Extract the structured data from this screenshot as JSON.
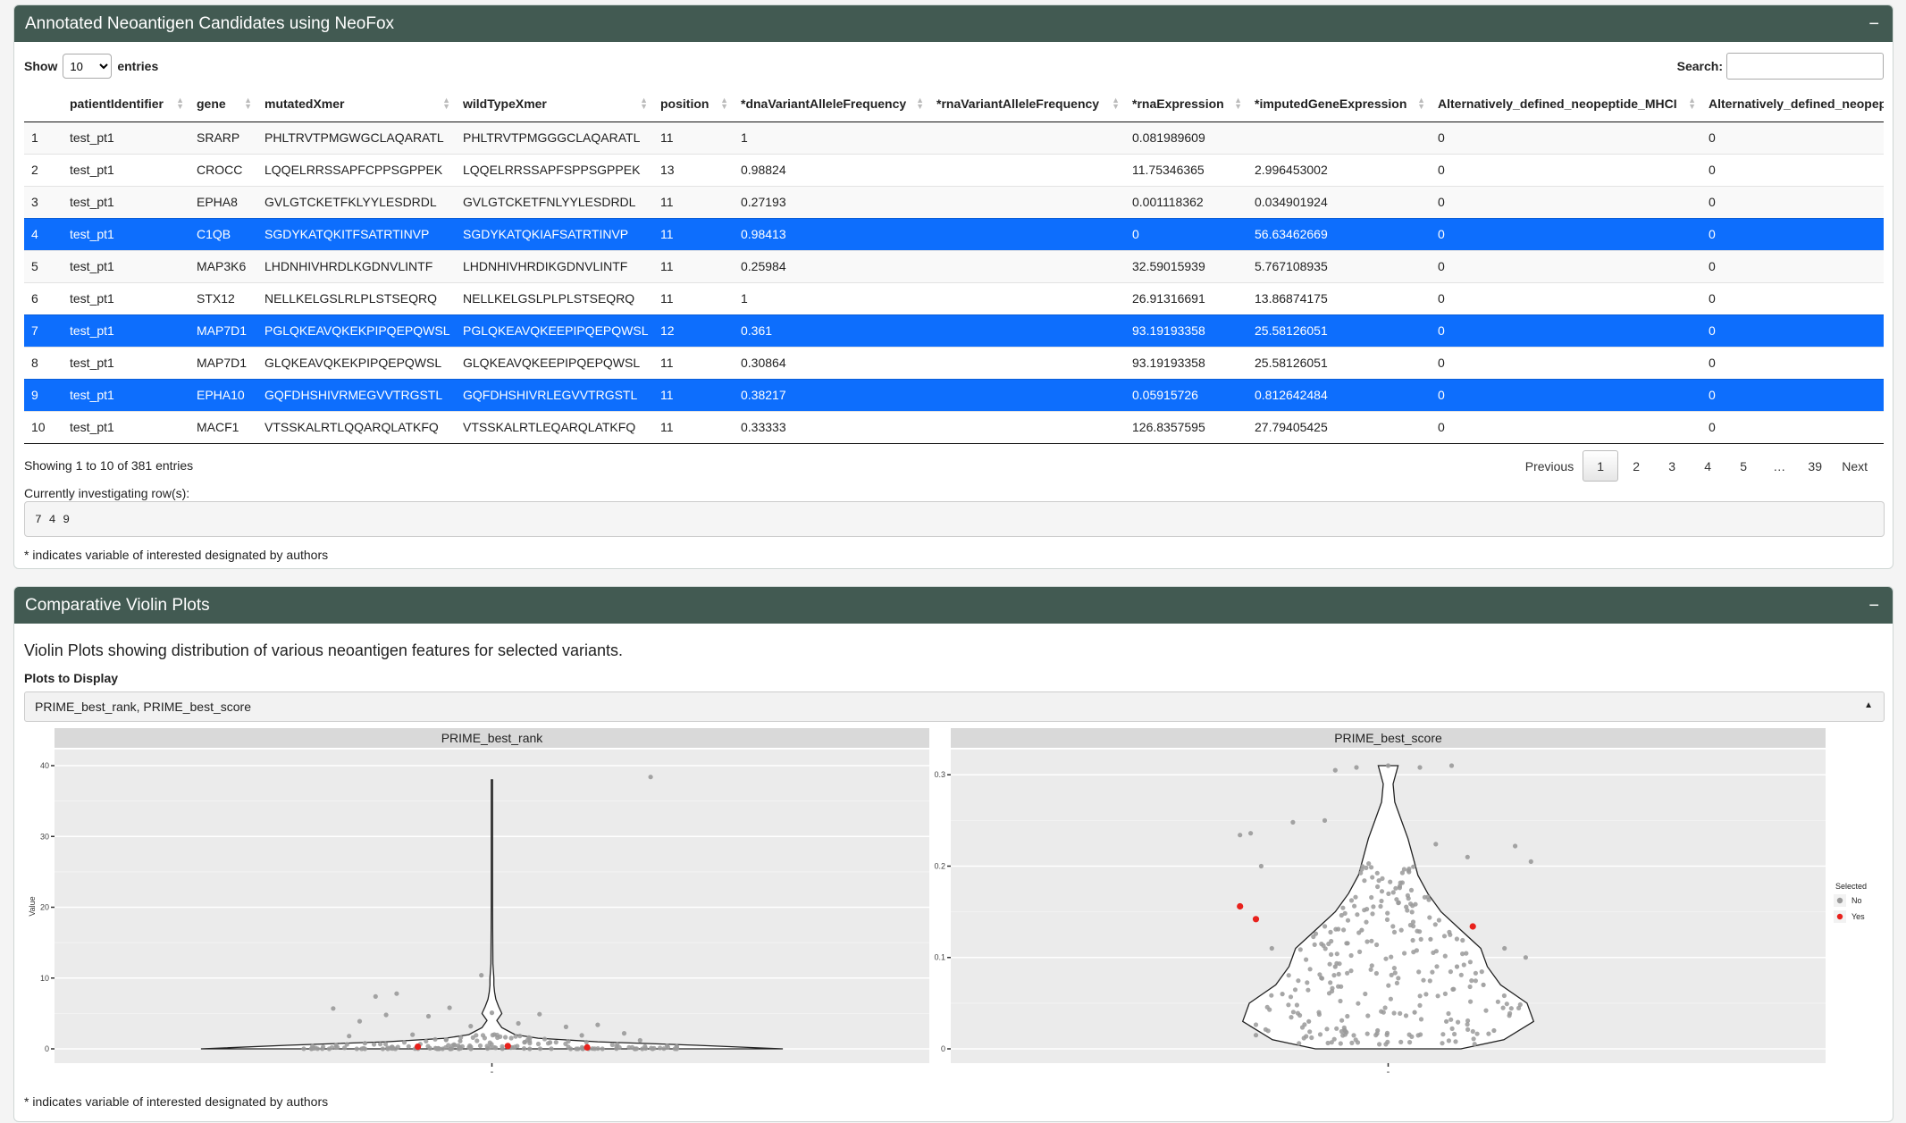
{
  "neofox_box": {
    "title": "Annotated Neoantigen Candidates using NeoFox",
    "collapse_glyph": "−",
    "show_label": "Show",
    "entries_label": "entries",
    "page_length": "10",
    "search_label": "Search:",
    "search_value": "",
    "columns": [
      "",
      "patientIdentifier",
      "gene",
      "mutatedXmer",
      "wildTypeXmer",
      "position",
      "*dnaVariantAlleleFrequency",
      "*rnaVariantAlleleFrequency",
      "*rnaExpression",
      "*imputedGeneExpression",
      "Alternatively_defined_neopeptide_MHCI",
      "Alternatively_defined_neopeptid"
    ],
    "rows": [
      {
        "cells": [
          "1",
          "test_pt1",
          "SRARP",
          "PHLTRVTPMGWGCLAQARATL",
          "PHLTRVTPMGGGCLAQARATL",
          "11",
          "1",
          "",
          "0.081989609",
          "",
          "0",
          "0"
        ],
        "selected": false
      },
      {
        "cells": [
          "2",
          "test_pt1",
          "CROCC",
          "LQQELRRSSAPFCPPSGPPEK",
          "LQQELRRSSAPFSPPSGPPEK",
          "13",
          "0.98824",
          "",
          "11.75346365",
          "2.996453002",
          "0",
          "0"
        ],
        "selected": false
      },
      {
        "cells": [
          "3",
          "test_pt1",
          "EPHA8",
          "GVLGTCKETFKLYYLESDRDL",
          "GVLGTCKETFNLYYLESDRDL",
          "11",
          "0.27193",
          "",
          "0.001118362",
          "0.034901924",
          "0",
          "0"
        ],
        "selected": false
      },
      {
        "cells": [
          "4",
          "test_pt1",
          "C1QB",
          "SGDYKATQKITFSATRTINVP",
          "SGDYKATQKIAFSATRTINVP",
          "11",
          "0.98413",
          "",
          "0",
          "56.63462669",
          "0",
          "0"
        ],
        "selected": true
      },
      {
        "cells": [
          "5",
          "test_pt1",
          "MAP3K6",
          "LHDNHIVHRDLKGDNVLINTF",
          "LHDNHIVHRDIKGDNVLINTF",
          "11",
          "0.25984",
          "",
          "32.59015939",
          "5.767108935",
          "0",
          "0"
        ],
        "selected": false
      },
      {
        "cells": [
          "6",
          "test_pt1",
          "STX12",
          "NELLKELGSLRLPLSTSEQRQ",
          "NELLKELGSLPLPLSTSEQRQ",
          "11",
          "1",
          "",
          "26.91316691",
          "13.86874175",
          "0",
          "0"
        ],
        "selected": false
      },
      {
        "cells": [
          "7",
          "test_pt1",
          "MAP7D1",
          "PGLQKEAVQKEKPIPQEPQWSL",
          "PGLQKEAVQKEEPIPQEPQWSL",
          "12",
          "0.361",
          "",
          "93.19193358",
          "25.58126051",
          "0",
          "0"
        ],
        "selected": true
      },
      {
        "cells": [
          "8",
          "test_pt1",
          "MAP7D1",
          "GLQKEAVQKEKPIPQEPQWSL",
          "GLQKEAVQKEEPIPQEPQWSL",
          "11",
          "0.30864",
          "",
          "93.19193358",
          "25.58126051",
          "0",
          "0"
        ],
        "selected": false
      },
      {
        "cells": [
          "9",
          "test_pt1",
          "EPHA10",
          "GQFDHSHIVRMEGVVTRGSTL",
          "GQFDHSHIVRLEGVVTRGSTL",
          "11",
          "0.38217",
          "",
          "0.05915726",
          "0.812642484",
          "0",
          "0"
        ],
        "selected": true
      },
      {
        "cells": [
          "10",
          "test_pt1",
          "MACF1",
          "VTSSKALRTLQQARQLATKFQ",
          "VTSSKALRTLEQARQLATKFQ",
          "11",
          "0.33333",
          "",
          "126.8357595",
          "27.79405425",
          "0",
          "0"
        ],
        "selected": false
      }
    ],
    "info": "Showing 1 to 10 of 381 entries",
    "pagination": {
      "previous": "Previous",
      "pages": [
        "1",
        "2",
        "3",
        "4",
        "5",
        "…",
        "39"
      ],
      "current": "1",
      "next": "Next"
    },
    "investigating_label": "Currently investigating row(s):",
    "investigating_rows": "7 4 9",
    "footnote": "* indicates variable of interested designated by authors"
  },
  "violin_box": {
    "title": "Comparative Violin Plots",
    "collapse_glyph": "−",
    "description": "Violin Plots showing distribution of various neoantigen features for selected variants.",
    "plots_label": "Plots to Display",
    "plots_selected": "PRIME_best_rank, PRIME_best_score",
    "caret": "▲",
    "footnote": "* indicates variable of interested designated by authors"
  },
  "colors": {
    "header_bg": "#425a52",
    "selected_row": "#0d6efd",
    "point_no": "#9a9a9a",
    "point_yes": "#e8211c",
    "panel_bg": "#ebebeb",
    "strip_bg": "#d9d9d9"
  },
  "chart_data": [
    {
      "type": "violin",
      "title": "PRIME_best_rank",
      "ylabel": "Value",
      "xlabel": "",
      "x_tick_labels": [
        "-"
      ],
      "ylim": [
        0,
        40
      ],
      "y_ticks": [
        0,
        10,
        20,
        30,
        40
      ],
      "grid": true,
      "violin_profile": [
        [
          0,
          0.88
        ],
        [
          0.5,
          0.62
        ],
        [
          1,
          0.32
        ],
        [
          1.5,
          0.14
        ],
        [
          2,
          0.07
        ],
        [
          3,
          0.03
        ],
        [
          4,
          0.015
        ],
        [
          5,
          0.03
        ],
        [
          6,
          0.02
        ],
        [
          7,
          0.012
        ],
        [
          8,
          0.008
        ],
        [
          9,
          0.006
        ],
        [
          10,
          0.006
        ],
        [
          12,
          0.003
        ],
        [
          20,
          0.002
        ],
        [
          38,
          0.002
        ]
      ],
      "points_selected": [
        {
          "x": -0.14,
          "y": 0.3
        },
        {
          "x": 0.03,
          "y": 0.4
        },
        {
          "x": 0.18,
          "y": 0.2
        }
      ],
      "points_not_selected_sample": [
        {
          "x": -0.3,
          "y": 5.7
        },
        {
          "x": -0.25,
          "y": 3.9
        },
        {
          "x": -0.22,
          "y": 7.4
        },
        {
          "x": -0.18,
          "y": 7.8
        },
        {
          "x": -0.2,
          "y": 4.8
        },
        {
          "x": -0.12,
          "y": 4.6
        },
        {
          "x": -0.08,
          "y": 5.8
        },
        {
          "x": -0.04,
          "y": 3.2
        },
        {
          "x": -0.02,
          "y": 10.4
        },
        {
          "x": 0.0,
          "y": 5.1
        },
        {
          "x": 0.05,
          "y": 3.6
        },
        {
          "x": 0.09,
          "y": 4.9
        },
        {
          "x": 0.14,
          "y": 3.1
        },
        {
          "x": 0.2,
          "y": 3.4
        },
        {
          "x": 0.3,
          "y": 38.4
        },
        {
          "x": -0.27,
          "y": 1.8
        },
        {
          "x": -0.15,
          "y": 2.0
        },
        {
          "x": 0.07,
          "y": 1.6
        },
        {
          "x": 0.17,
          "y": 1.9
        },
        {
          "x": 0.25,
          "y": 2.2
        },
        {
          "x": -0.24,
          "y": 0.8
        },
        {
          "x": -0.06,
          "y": 1.1
        },
        {
          "x": 0.11,
          "y": 0.9
        },
        {
          "x": 0.28,
          "y": 1.2
        }
      ]
    },
    {
      "type": "violin",
      "title": "PRIME_best_score",
      "ylabel": "",
      "xlabel": "",
      "x_tick_labels": [
        "-"
      ],
      "ylim": [
        0,
        0.31
      ],
      "y_ticks": [
        0.0,
        0.1,
        0.2,
        0.3
      ],
      "grid": true,
      "violin_profile": [
        [
          0,
          0.22
        ],
        [
          0.01,
          0.35
        ],
        [
          0.03,
          0.44
        ],
        [
          0.05,
          0.42
        ],
        [
          0.07,
          0.34
        ],
        [
          0.09,
          0.3
        ],
        [
          0.11,
          0.28
        ],
        [
          0.13,
          0.22
        ],
        [
          0.15,
          0.16
        ],
        [
          0.17,
          0.12
        ],
        [
          0.19,
          0.09
        ],
        [
          0.21,
          0.075
        ],
        [
          0.23,
          0.06
        ],
        [
          0.25,
          0.04
        ],
        [
          0.27,
          0.02
        ],
        [
          0.29,
          0.015
        ],
        [
          0.31,
          0.03
        ]
      ],
      "points_selected": [
        {
          "x": -0.28,
          "y": 0.156
        },
        {
          "x": -0.25,
          "y": 0.142
        },
        {
          "x": 0.16,
          "y": 0.134
        }
      ],
      "points_not_selected_sample": [
        {
          "x": -0.28,
          "y": 0.234
        },
        {
          "x": -0.26,
          "y": 0.236
        },
        {
          "x": -0.24,
          "y": 0.2
        },
        {
          "x": -0.22,
          "y": 0.11
        },
        {
          "x": -0.18,
          "y": 0.248
        },
        {
          "x": -0.12,
          "y": 0.25
        },
        {
          "x": -0.1,
          "y": 0.305
        },
        {
          "x": -0.06,
          "y": 0.308
        },
        {
          "x": 0.0,
          "y": 0.31
        },
        {
          "x": 0.06,
          "y": 0.308
        },
        {
          "x": 0.12,
          "y": 0.31
        },
        {
          "x": 0.09,
          "y": 0.224
        },
        {
          "x": 0.15,
          "y": 0.21
        },
        {
          "x": 0.24,
          "y": 0.222
        },
        {
          "x": 0.27,
          "y": 0.205
        },
        {
          "x": -0.2,
          "y": 0.06
        },
        {
          "x": -0.1,
          "y": 0.09
        },
        {
          "x": -0.05,
          "y": 0.13
        },
        {
          "x": 0.02,
          "y": 0.16
        },
        {
          "x": 0.08,
          "y": 0.12
        },
        {
          "x": 0.13,
          "y": 0.09
        },
        {
          "x": 0.18,
          "y": 0.07
        },
        {
          "x": 0.22,
          "y": 0.11
        },
        {
          "x": -0.15,
          "y": 0.03
        },
        {
          "x": -0.02,
          "y": 0.02
        },
        {
          "x": 0.05,
          "y": 0.04
        },
        {
          "x": 0.11,
          "y": 0.03
        },
        {
          "x": 0.2,
          "y": 0.02
        },
        {
          "x": -0.25,
          "y": 0.015
        },
        {
          "x": 0.26,
          "y": 0.1
        }
      ]
    }
  ],
  "legend": {
    "title": "Selected",
    "items": [
      {
        "label": "No",
        "color": "#9a9a9a"
      },
      {
        "label": "Yes",
        "color": "#e8211c"
      }
    ]
  }
}
